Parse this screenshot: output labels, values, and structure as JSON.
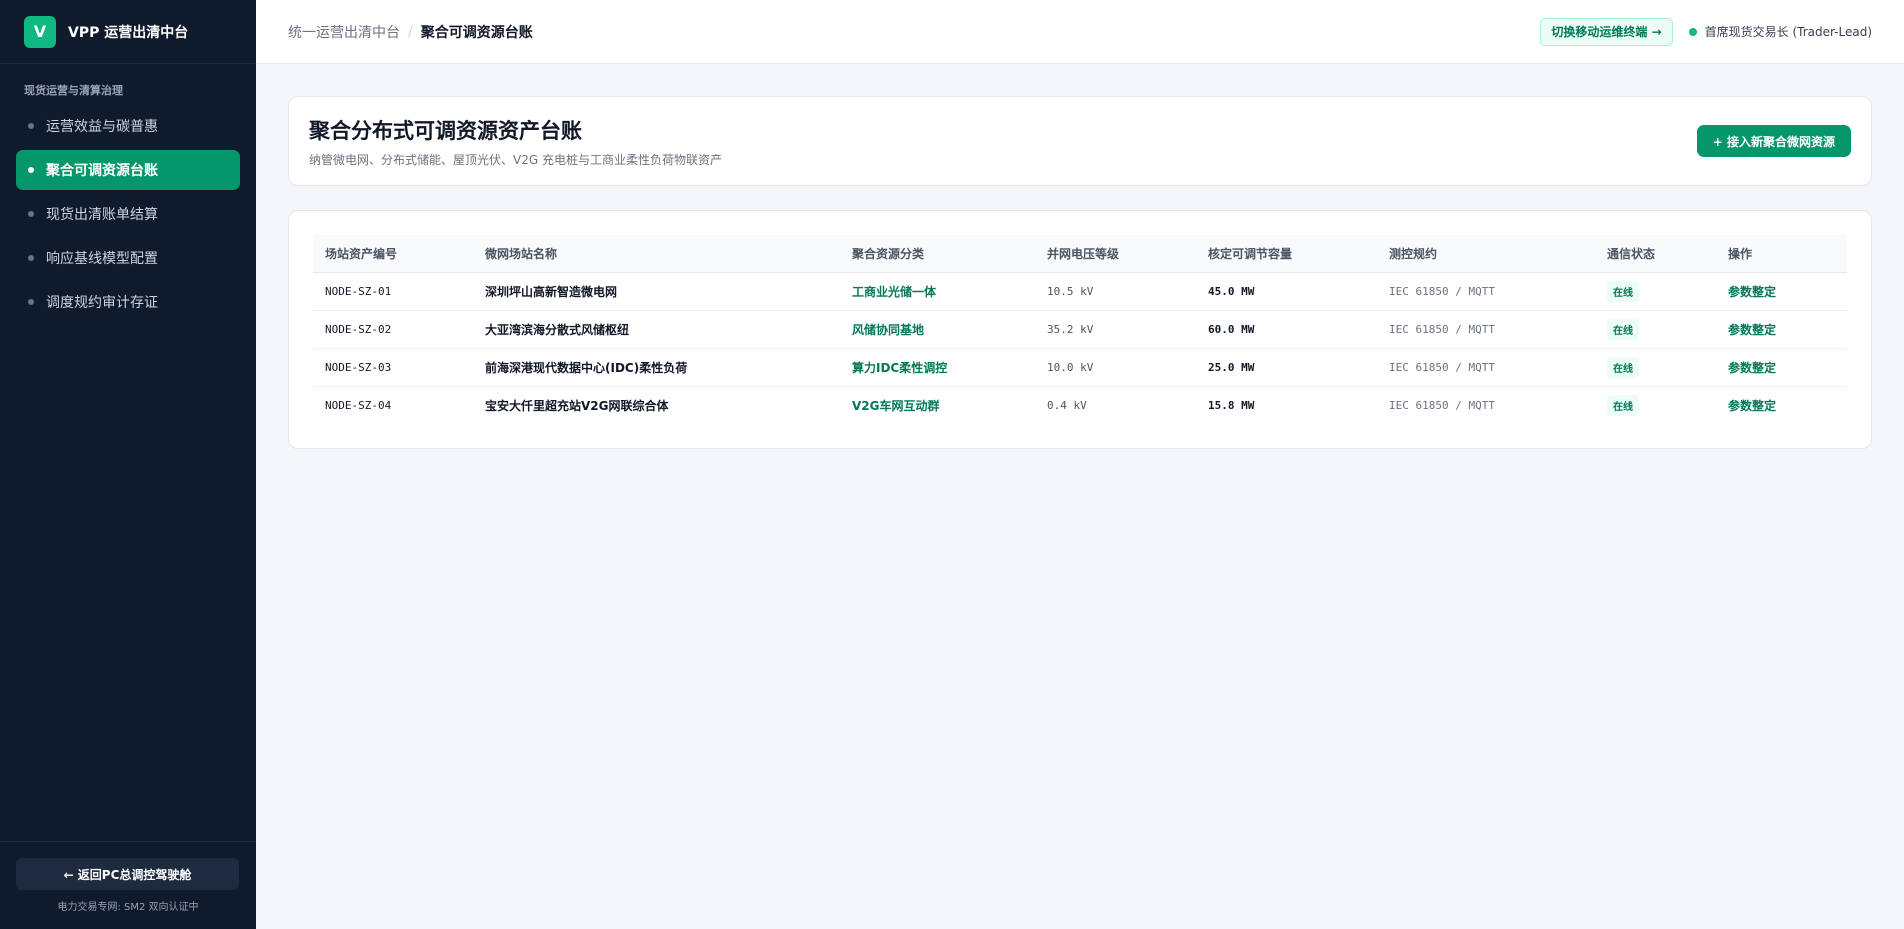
{
  "brand": {
    "logo_letter": "V",
    "name": "VPP 运营出清中台"
  },
  "sidebar": {
    "section_title": "现货运营与清算治理",
    "items": [
      {
        "label": "运营效益与碳普惠",
        "active": false
      },
      {
        "label": "聚合可调资源台账",
        "active": true
      },
      {
        "label": "现货出清账单结算",
        "active": false
      },
      {
        "label": "响应基线模型配置",
        "active": false
      },
      {
        "label": "调度规约审计存证",
        "active": false
      }
    ],
    "back_button": "← 返回PC总调控驾驶舱",
    "footer_note": "电力交易专网: SM2 双向认证中"
  },
  "topbar": {
    "breadcrumb_root": "统一运营出清中台",
    "breadcrumb_sep": "/",
    "breadcrumb_current": "聚合可调资源台账",
    "switch_button": "切换移动运维终端 →",
    "user": "首席现货交易长 (Trader-Lead)"
  },
  "header": {
    "title": "聚合分布式可调资源资产台账",
    "subtitle": "纳管微电网、分布式储能、屋顶光伏、V2G 充电桩与工商业柔性负荷物联资产",
    "add_button": "+ 接入新聚合微网资源"
  },
  "table": {
    "columns": [
      "场站资产编号",
      "微网场站名称",
      "聚合资源分类",
      "并网电压等级",
      "核定可调节容量",
      "测控规约",
      "通信状态",
      "操作"
    ],
    "rows": [
      {
        "id": "NODE-SZ-01",
        "name": "深圳坪山高新智造微电网",
        "category": "工商业光储一体",
        "voltage": "10.5 kV",
        "capacity": "45.0 MW",
        "protocol": "IEC 61850 / MQTT",
        "status": "在线",
        "action": "参数整定"
      },
      {
        "id": "NODE-SZ-02",
        "name": "大亚湾滨海分散式风储枢纽",
        "category": "风储协同基地",
        "voltage": "35.2 kV",
        "capacity": "60.0 MW",
        "protocol": "IEC 61850 / MQTT",
        "status": "在线",
        "action": "参数整定"
      },
      {
        "id": "NODE-SZ-03",
        "name": "前海深港现代数据中心(IDC)柔性负荷",
        "category": "算力IDC柔性调控",
        "voltage": "10.0 kV",
        "capacity": "25.0 MW",
        "protocol": "IEC 61850 / MQTT",
        "status": "在线",
        "action": "参数整定"
      },
      {
        "id": "NODE-SZ-04",
        "name": "宝安大仟里超充站V2G网联综合体",
        "category": "V2G车网互动群",
        "voltage": "0.4 kV",
        "capacity": "15.8 MW",
        "protocol": "IEC 61850 / MQTT",
        "status": "在线",
        "action": "参数整定"
      }
    ]
  },
  "colors": {
    "accent": "#059669",
    "sidebar_bg": "#0f1a2d",
    "status_online": "#10b981"
  }
}
